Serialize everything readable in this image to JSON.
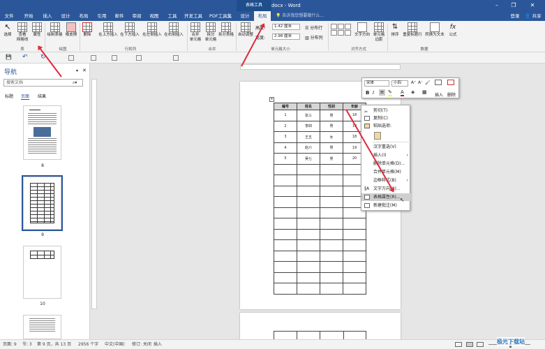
{
  "window": {
    "title": "Word教程2.docx - Word",
    "context_group": "表格工具",
    "min_icon": "minimize-icon",
    "max_icon": "restore-icon",
    "close_icon": "close-icon"
  },
  "tabs": [
    "文件",
    "开始",
    "插入",
    "设计",
    "布局",
    "引用",
    "邮件",
    "审阅",
    "视图",
    "工具",
    "开发工具",
    "PDF工具集",
    "设计",
    "布局"
  ],
  "active_tab": "布局",
  "tell_me": "告诉我您想要做什么...",
  "account": {
    "login": "登录",
    "share": "共享"
  },
  "ribbon": {
    "buttons": [
      "选择",
      "查看\n网格线",
      "属性",
      "绘制表格",
      "橡皮擦",
      "删除",
      "在上方插入",
      "在下方插入",
      "在左侧插入",
      "在右侧插入",
      "合并\n单元格",
      "拆分\n单元格",
      "拆分表格",
      "自动调整",
      "文字方向",
      "单元格\n边距",
      "排序",
      "重复标题行",
      "转换为文本",
      "公式"
    ],
    "groups": [
      "表",
      "绘图",
      "行和列",
      "合并",
      "单元格大小",
      "对齐方式",
      "数据"
    ],
    "height_label": "高度:",
    "height_value": "1.42 厘米",
    "width_label": "宽度:",
    "width_value": "2.98 厘米",
    "dist_rows": "分布行",
    "dist_cols": "分布列"
  },
  "nav": {
    "title": "导航",
    "search_placeholder": "搜索文档",
    "tabs": [
      "标题",
      "页面",
      "结果"
    ],
    "active_tab": "页面",
    "pages": [
      "8",
      "9",
      "10"
    ]
  },
  "table": {
    "headers": [
      "编号",
      "姓名",
      "性别",
      "年龄"
    ],
    "rows": [
      [
        "1",
        "张三",
        "男",
        "18"
      ],
      [
        "2",
        "李四",
        "男",
        "19"
      ],
      [
        "3",
        "王五",
        "女",
        "18"
      ],
      [
        "4",
        "赵六",
        "男",
        "19"
      ],
      [
        "5",
        "吴七",
        "男",
        "20"
      ]
    ],
    "empty_rows": 12
  },
  "mini_toolbar": {
    "font": "宋体",
    "size": "小四",
    "insert": "插入",
    "delete": "删除"
  },
  "context_menu": [
    {
      "label": "剪切(T)",
      "icon": "scissors-icon"
    },
    {
      "label": "复制(C)",
      "icon": "copy-icon"
    },
    {
      "label": "粘贴选项:",
      "icon": "paste-icon"
    },
    {
      "label": "汉字重选(V)",
      "icon": ""
    },
    {
      "label": "插入(I)",
      "icon": ""
    },
    {
      "label": "删除单元格(D)...",
      "icon": ""
    },
    {
      "label": "合并单元格(M)",
      "icon": ""
    },
    {
      "label": "边框样式(B)",
      "icon": ""
    },
    {
      "label": "文字方向(X)...",
      "icon": "text-direction-icon"
    },
    {
      "label": "表格属性(R)...",
      "icon": "table-properties-icon"
    },
    {
      "label": "新建批注(M)",
      "icon": "comment-icon"
    }
  ],
  "status": {
    "page": "页面: 9",
    "section": "节: 3",
    "pages": "第 9 页，共 13 页",
    "words": "2956 个字",
    "lang": "中文(中国)",
    "revisions": "修订: 关闭",
    "mode": "插入"
  },
  "watermark": "极光下载站"
}
